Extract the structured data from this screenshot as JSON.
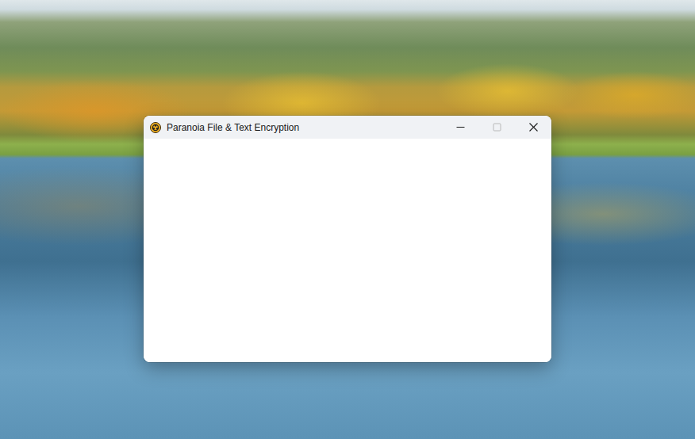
{
  "window": {
    "title": "Paranoia File & Text Encryption"
  },
  "controls": [
    {
      "kind": "minimize",
      "disabled": false
    },
    {
      "kind": "maximize",
      "disabled": true
    },
    {
      "kind": "close",
      "disabled": false
    }
  ]
}
